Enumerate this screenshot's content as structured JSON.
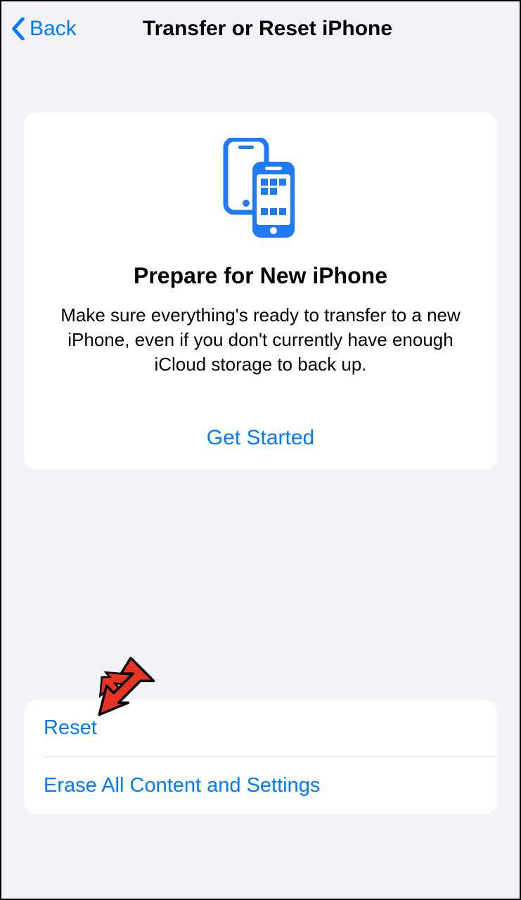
{
  "header": {
    "back_label": "Back",
    "title": "Transfer or Reset iPhone"
  },
  "prepare_card": {
    "icon_name": "two-iphones-icon",
    "title": "Prepare for New iPhone",
    "description": "Make sure everything's ready to transfer to a new iPhone, even if you don't currently have enough iCloud storage to back up.",
    "action_label": "Get Started"
  },
  "options": {
    "reset_label": "Reset",
    "erase_label": "Erase All Content and Settings"
  },
  "annotation": {
    "arrow_target": "reset-option"
  },
  "colors": {
    "accent": "#007aff",
    "background": "#f2f2f7",
    "card_bg": "#ffffff",
    "arrow": "#e53424"
  }
}
